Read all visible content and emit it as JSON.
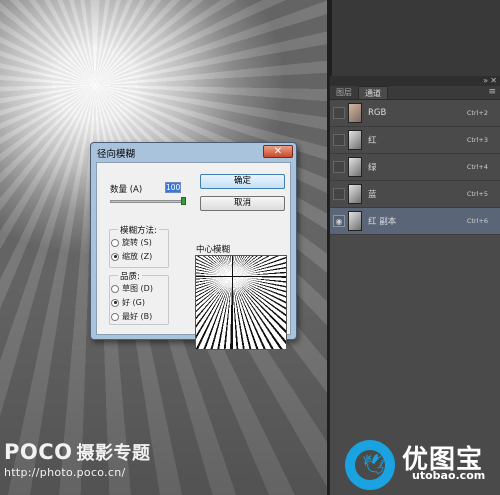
{
  "watermark": {
    "brand": "POCO",
    "brand_sub": "摄影专题",
    "url": "http://photo.poco.cn/"
  },
  "channels_panel": {
    "tabs": [
      "图层",
      "通道"
    ],
    "active_tab": "通道",
    "panel_menu_icon": "menu-icon",
    "channels": [
      {
        "name": "RGB",
        "shortcut": "Ctrl+2",
        "thumb": "color"
      },
      {
        "name": "红",
        "shortcut": "Ctrl+3",
        "thumb": "gray"
      },
      {
        "name": "绿",
        "shortcut": "Ctrl+4",
        "thumb": "gray"
      },
      {
        "name": "蓝",
        "shortcut": "Ctrl+5",
        "thumb": "gray"
      },
      {
        "name": "红 副本",
        "shortcut": "Ctrl+6",
        "thumb": "gray",
        "selected": true,
        "visible": true
      }
    ]
  },
  "dialog": {
    "title": "径向模糊",
    "amount_label": "数量 (A)",
    "amount_value": "100",
    "amount_fraction": 1.0,
    "ok_label": "确定",
    "cancel_label": "取消",
    "blur_method": {
      "title": "模糊方法:",
      "options": [
        "旋转 (S)",
        "缩放 (Z)"
      ],
      "selected": "缩放 (Z)"
    },
    "quality": {
      "title": "品质:",
      "options": [
        "草图 (D)",
        "好 (G)",
        "最好 (B)"
      ],
      "selected": "好 (G)"
    },
    "preview_title": "中心模糊"
  },
  "logo": {
    "text": "优图宝",
    "url": "utobao.com"
  },
  "colors": {
    "selected_row": "#5a6678",
    "logo_blue": "#1aa3e0",
    "dialog_frame": "#a9c3dc"
  }
}
